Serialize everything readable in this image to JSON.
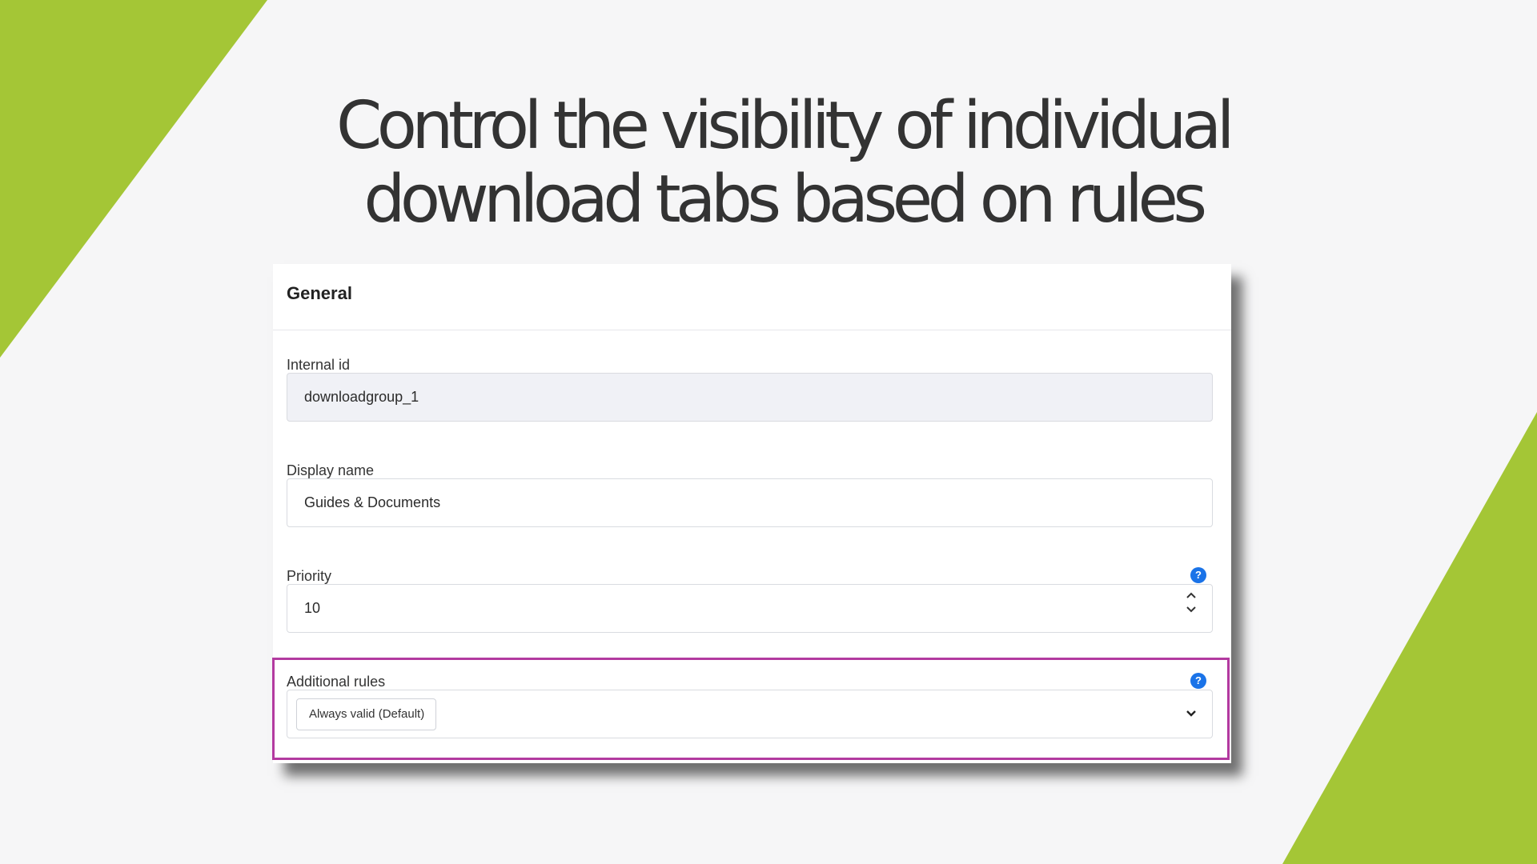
{
  "headline": {
    "line1": "Control the visibility of individual",
    "line2": "download tabs based on rules"
  },
  "colors": {
    "accent_green": "#a4c636",
    "highlight_border": "#b33aa0",
    "help_icon": "#1a73e8",
    "background": "#f6f6f7"
  },
  "panel": {
    "title": "General",
    "fields": {
      "internal_id": {
        "label": "Internal id",
        "value": "downloadgroup_1",
        "readonly": true
      },
      "display_name": {
        "label": "Display name",
        "value": "Guides & Documents"
      },
      "priority": {
        "label": "Priority",
        "value": "10",
        "help_icon": "question-circle-icon",
        "control": "number-stepper"
      },
      "additional_rules": {
        "label": "Additional rules",
        "selected": "Always valid (Default)",
        "help_icon": "question-circle-icon",
        "control": "multiselect-dropdown"
      }
    }
  },
  "icons": {
    "help": "?",
    "stepper_up": "chevron-up-icon",
    "stepper_down": "chevron-down-icon",
    "dropdown": "chevron-down-icon"
  }
}
